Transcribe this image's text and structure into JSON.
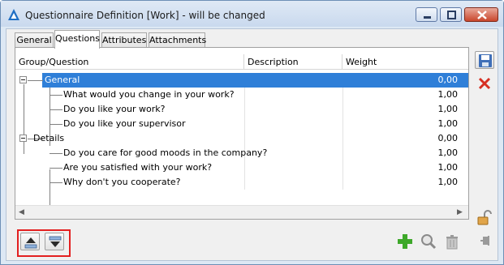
{
  "window": {
    "title": "Questionnaire Definition [Work] - will be changed",
    "controls": [
      "minimize",
      "maximize",
      "close"
    ]
  },
  "tabs": [
    {
      "label": "General",
      "active": false
    },
    {
      "label": "Questions",
      "active": true
    },
    {
      "label": "Attributes",
      "active": false
    },
    {
      "label": "Attachments",
      "active": false
    }
  ],
  "grid": {
    "columns": [
      "Group/Question",
      "Description",
      "Weight"
    ],
    "rows": [
      {
        "type": "group",
        "label": "General",
        "description": "",
        "weight": "0,00",
        "selected": true
      },
      {
        "type": "question",
        "label": "What would you change in your work?",
        "description": "",
        "weight": "1,00"
      },
      {
        "type": "question",
        "label": "Do you like your work?",
        "description": "",
        "weight": "1,00"
      },
      {
        "type": "question",
        "label": "Do you like your supervisor",
        "description": "",
        "weight": "1,00"
      },
      {
        "type": "group",
        "label": "Details",
        "description": "",
        "weight": "0,00",
        "selected": false
      },
      {
        "type": "question",
        "label": "Do you care for good moods in the company?",
        "description": "",
        "weight": "1,00"
      },
      {
        "type": "question",
        "label": "Are you satisfied with your work?",
        "description": "",
        "weight": "1,00"
      },
      {
        "type": "question",
        "label": "Why don't you cooperate?",
        "description": "",
        "weight": "1,00"
      }
    ]
  },
  "toolbar": {
    "side": [
      "save-icon",
      "cancel-icon",
      "lock-icon",
      "pin-icon"
    ],
    "bottom_left": [
      "move-up-icon",
      "move-down-icon"
    ],
    "bottom_right": [
      "add-icon",
      "preview-icon",
      "delete-icon"
    ]
  },
  "colors": {
    "selection": "#2f7fd8",
    "highlight": "#e32020",
    "add_green": "#3ea82a",
    "cancel_red": "#d62f22"
  }
}
